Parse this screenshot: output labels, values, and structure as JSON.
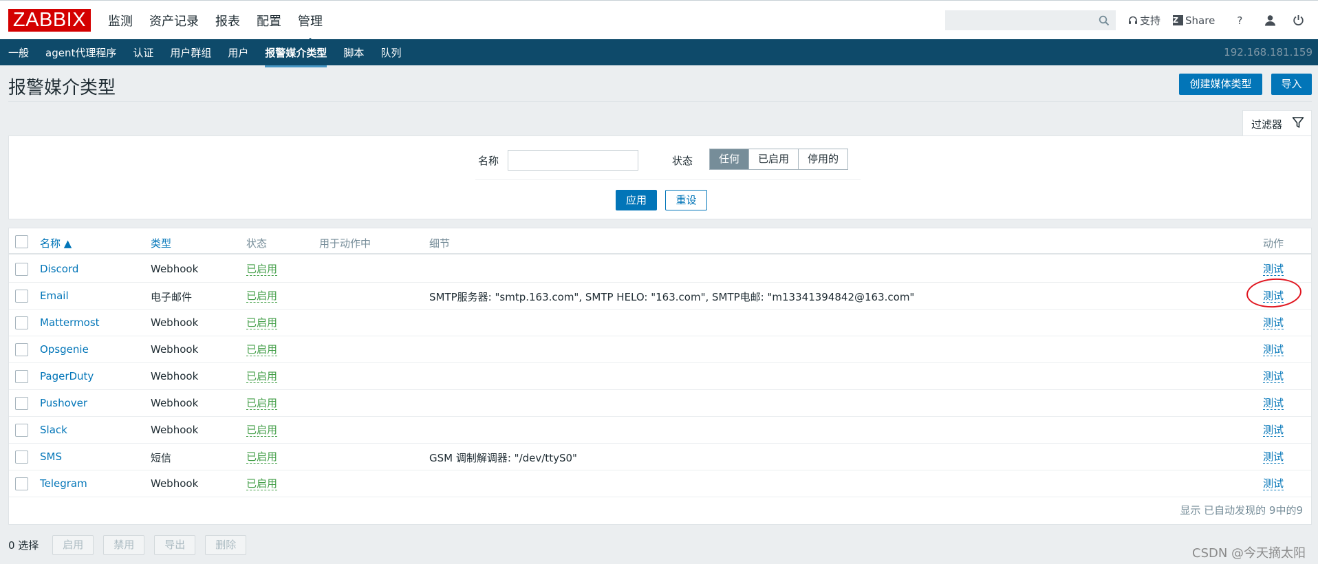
{
  "header": {
    "logo": "ZABBIX",
    "menu": [
      "监测",
      "资产记录",
      "报表",
      "配置",
      "管理"
    ],
    "active_menu": "管理",
    "links": {
      "support": "支持",
      "share": "Share",
      "help": "?"
    }
  },
  "subnav": {
    "items": [
      "一般",
      "agent代理程序",
      "认证",
      "用户群组",
      "用户",
      "报警媒介类型",
      "脚本",
      "队列"
    ],
    "active": "报警媒介类型",
    "ip": "192.168.181.159"
  },
  "page": {
    "title": "报警媒介类型",
    "create_button": "创建媒体类型",
    "import_button": "导入"
  },
  "filter": {
    "tab_label": "过滤器",
    "name_label": "名称",
    "name_value": "",
    "status_label": "状态",
    "status_options": [
      "任何",
      "已启用",
      "停用的"
    ],
    "status_selected": "任何",
    "apply": "应用",
    "reset": "重设"
  },
  "table": {
    "headers": {
      "name": "名称 ▲",
      "type": "类型",
      "status": "状态",
      "used": "用于动作中",
      "details": "细节",
      "action": "动作"
    },
    "rows": [
      {
        "name": "Discord",
        "type": "Webhook",
        "status": "已启用",
        "details": "",
        "action": "测试"
      },
      {
        "name": "Email",
        "type": "电子邮件",
        "status": "已启用",
        "details": "SMTP服务器: \"smtp.163.com\", SMTP HELO: \"163.com\", SMTP电邮: \"m13341394842@163.com\"",
        "action": "测试"
      },
      {
        "name": "Mattermost",
        "type": "Webhook",
        "status": "已启用",
        "details": "",
        "action": "测试"
      },
      {
        "name": "Opsgenie",
        "type": "Webhook",
        "status": "已启用",
        "details": "",
        "action": "测试"
      },
      {
        "name": "PagerDuty",
        "type": "Webhook",
        "status": "已启用",
        "details": "",
        "action": "测试"
      },
      {
        "name": "Pushover",
        "type": "Webhook",
        "status": "已启用",
        "details": "",
        "action": "测试"
      },
      {
        "name": "Slack",
        "type": "Webhook",
        "status": "已启用",
        "details": "",
        "action": "测试"
      },
      {
        "name": "SMS",
        "type": "短信",
        "status": "已启用",
        "details": "GSM 调制解调器: \"/dev/ttyS0\"",
        "action": "测试"
      },
      {
        "name": "Telegram",
        "type": "Webhook",
        "status": "已启用",
        "details": "",
        "action": "测试"
      }
    ],
    "footer": "显示 已自动发现的 9中的9"
  },
  "bottom": {
    "selected": "0 选择",
    "buttons": [
      "启用",
      "禁用",
      "导出",
      "删除"
    ]
  },
  "watermark": "CSDN @今天摘太阳",
  "colors": {
    "brand": "#d40000",
    "nav": "#0e4a6a",
    "accent": "#0275b8",
    "enabled": "#429e47",
    "annotation": "#e0141e"
  }
}
